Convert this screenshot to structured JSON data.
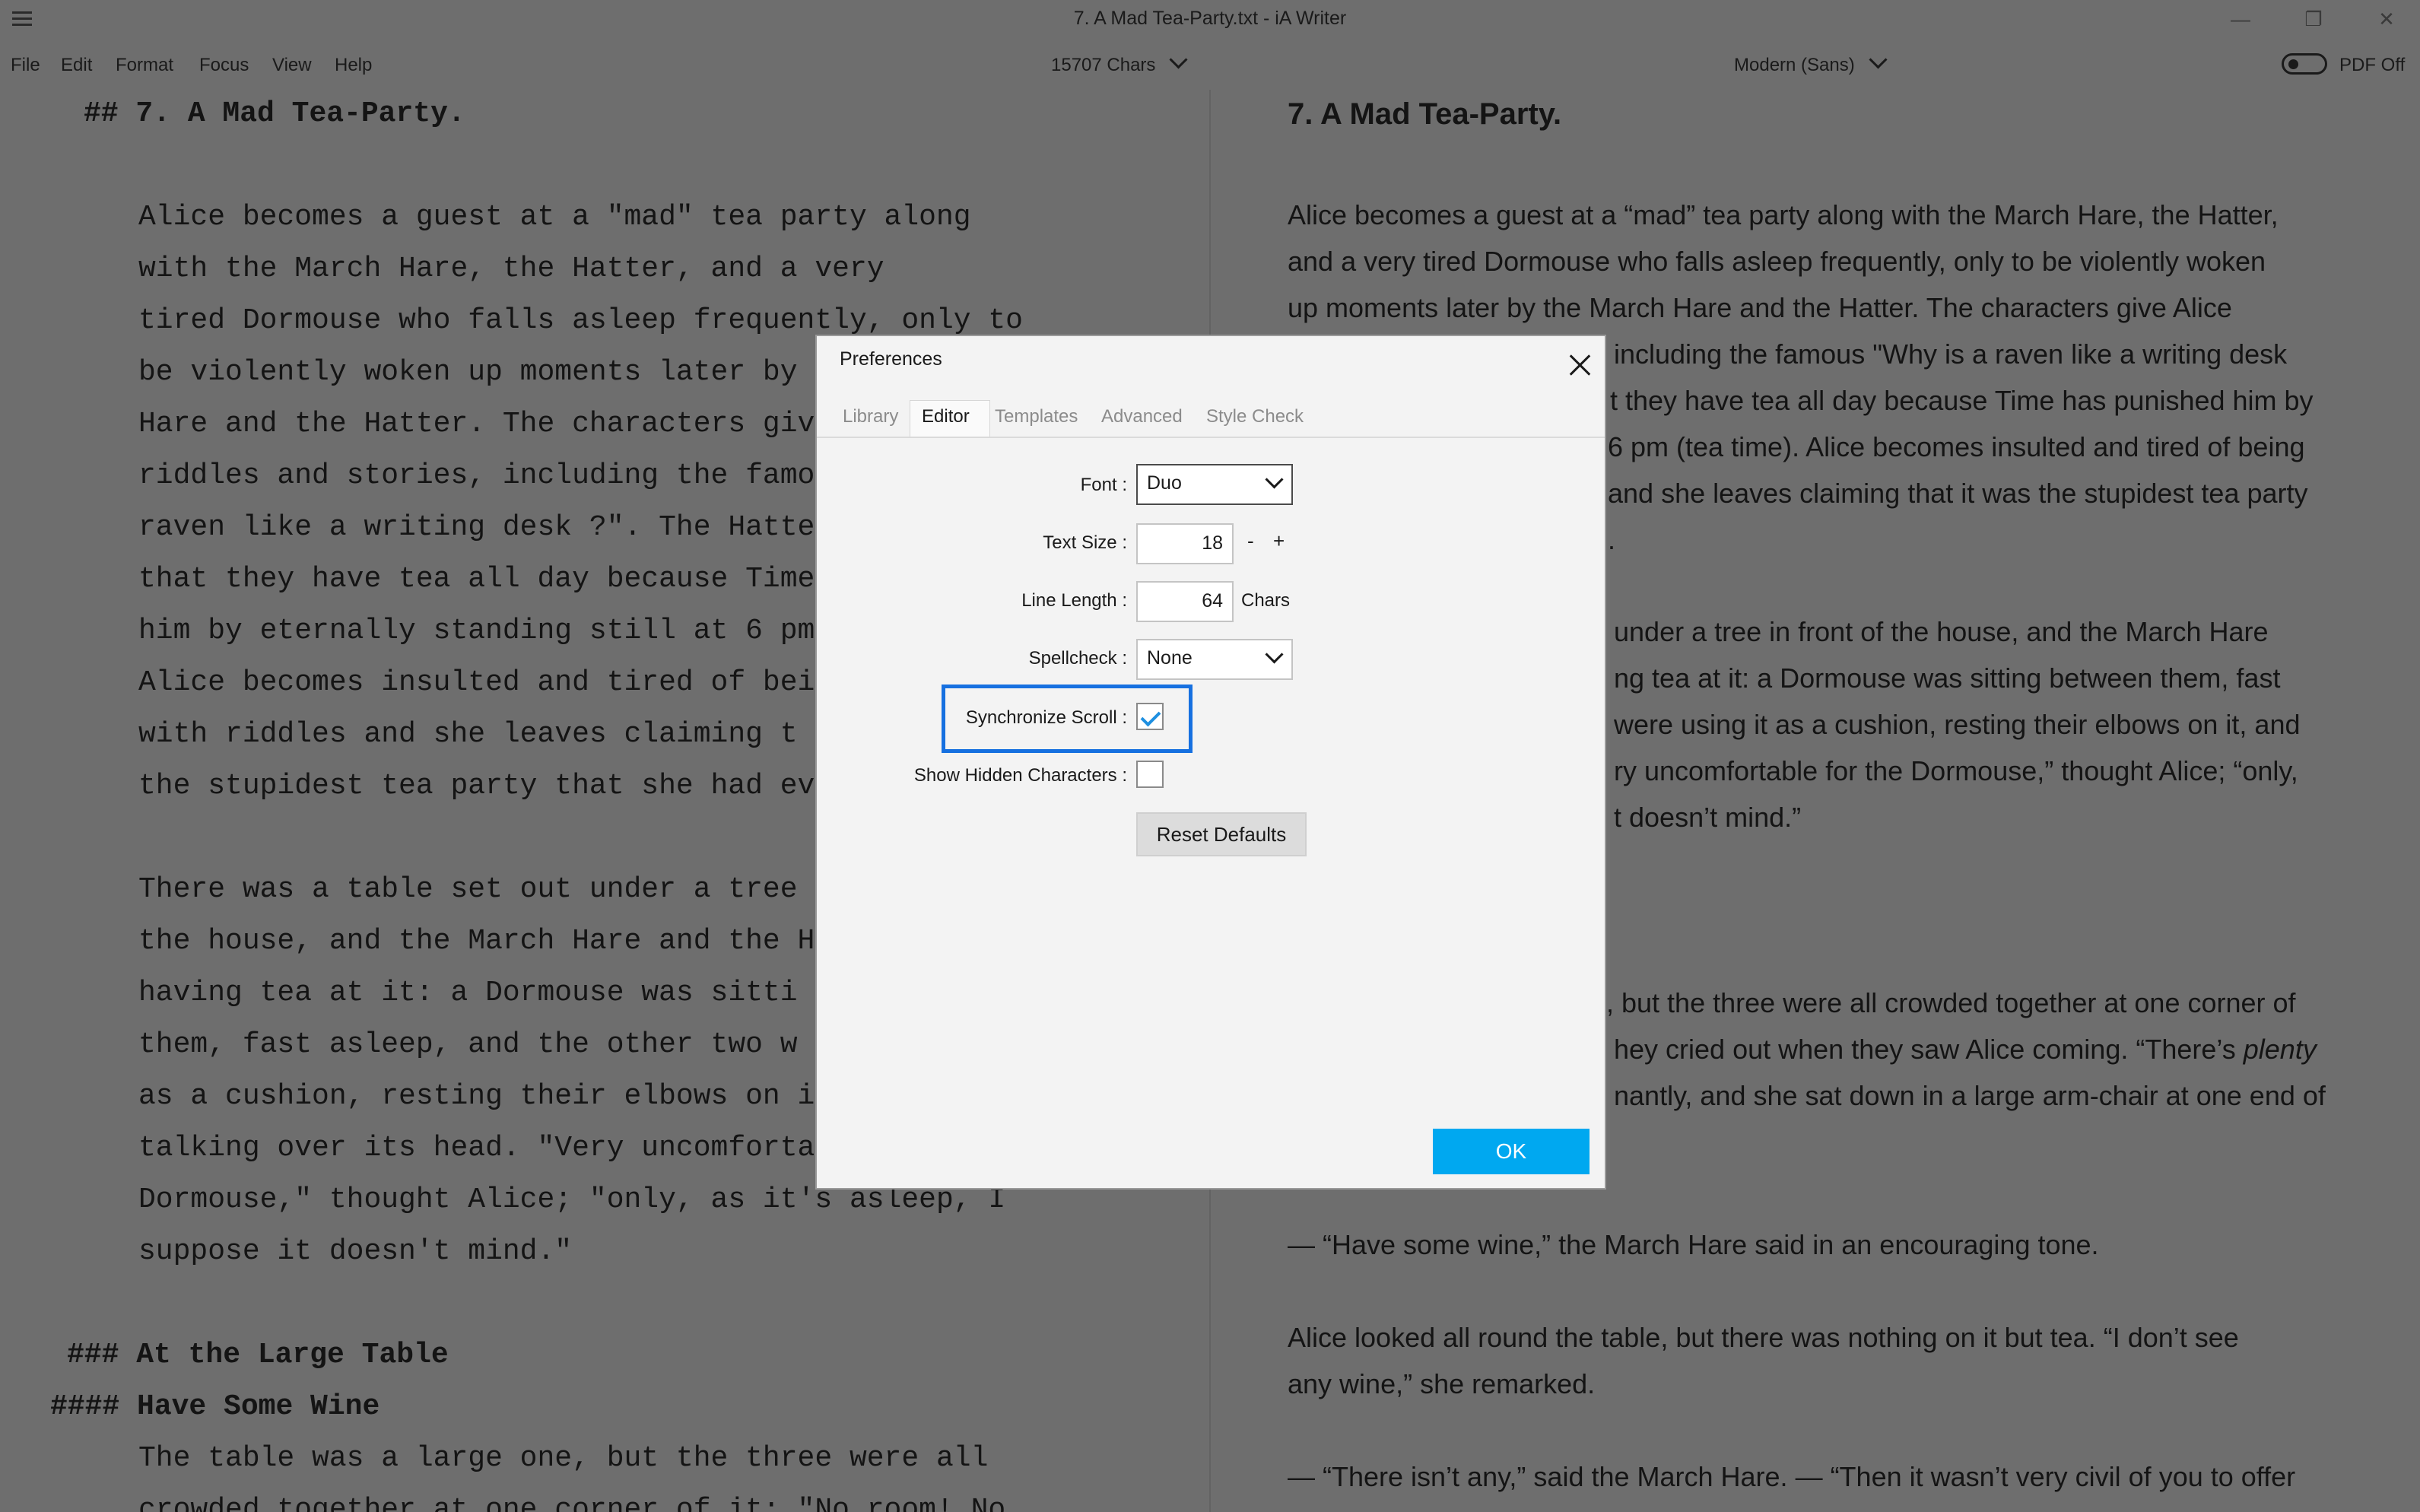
{
  "window": {
    "title": "7. A Mad Tea-Party.txt - iA Writer",
    "minimize": "—",
    "maximize": "❐",
    "close": "✕"
  },
  "menu": {
    "items": [
      "File",
      "Edit",
      "Format",
      "Focus",
      "View",
      "Help"
    ],
    "char_count": "15707 Chars",
    "font_style": "Modern (Sans)",
    "pdf_label": "PDF Off"
  },
  "editor": {
    "lines": [
      "## 7. A Mad Tea-Party.",
      "",
      "Alice becomes a guest at a \"mad\" tea party along",
      "with the March Hare, the Hatter, and a very",
      "tired Dormouse who falls asleep frequently, only to",
      "be violently woken up moments later by",
      "Hare and the Hatter. The characters giv",
      "riddles and stories, including the famo",
      "raven like a writing desk ?\". The Hatte",
      "that they have tea all day because Time",
      "him by eternally standing still at 6 pm",
      "Alice becomes insulted and tired of bei",
      "with riddles and she leaves claiming t",
      "the stupidest tea party that she had ev",
      "",
      "There was a table set out under a tree",
      "the house, and the March Hare and the H",
      "having tea at it: a Dormouse was sitti",
      "them, fast asleep, and the other two w",
      "as a cushion, resting their elbows on i",
      "talking over its head. \"Very uncomforta",
      "Dormouse,\" thought Alice; \"only, as it's asleep, I",
      "suppose it doesn't mind.\"",
      "",
      "### At the Large Table",
      "#### Have Some Wine",
      "The table was a large one, but the three were all",
      "crowded together at one corner of it: \"No room! No"
    ]
  },
  "preview": {
    "heading": "7. A Mad Tea-Party.",
    "lines": [
      "Alice becomes a guest at a “mad” tea party along with the March Hare, the Hatter,",
      "and a very tired Dormouse who falls asleep frequently, only to be violently woken",
      "up moments later by the March Hare and the Hatter. The characters give Alice",
      "including the famous \"Why is a raven like a writing desk",
      "t they have tea all day because Time has punished him by",
      "6 pm (tea time). Alice becomes insulted and tired of being",
      "and she leaves claiming that it was the stupidest tea party",
      ".",
      "under a tree in front of the house, and the March Hare",
      "ng tea at it: a Dormouse was sitting between them, fast",
      "were using it as a cushion, resting their elbows on it, and",
      "ry uncomfortable for the Dormouse,” thought Alice; “only,",
      "t doesn’t mind.”",
      ", but the three were all crowded together at one corner of",
      "hey cried out when they saw Alice coming. “There’s",
      "nantly, and she sat down in a large arm-chair at one end of",
      "— “Have some wine,” the March Hare said in an encouraging tone.",
      "Alice looked all round the table, but there was nothing on it but tea. “I don’t see",
      "any wine,” she remarked.",
      "— “There isn’t any,” said the March Hare. — “Then it wasn’t very civil of you to offer"
    ],
    "italic_word": "plenty"
  },
  "dialog": {
    "title": "Preferences",
    "tabs": [
      "Library",
      "Editor",
      "Templates",
      "Advanced",
      "Style Check"
    ],
    "active_tab": "Editor",
    "font_label": "Font :",
    "font_value": "Duo",
    "text_size_label": "Text Size :",
    "text_size_value": "18",
    "minus": "-",
    "plus": "+",
    "line_length_label": "Line Length :",
    "line_length_value": "64",
    "line_length_unit": "Chars",
    "spellcheck_label": "Spellcheck :",
    "spellcheck_value": "None",
    "sync_scroll_label": "Synchronize Scroll :",
    "sync_scroll_checked": true,
    "hidden_chars_label": "Show Hidden Characters :",
    "hidden_chars_checked": false,
    "reset_label": "Reset Defaults",
    "ok_label": "OK"
  }
}
